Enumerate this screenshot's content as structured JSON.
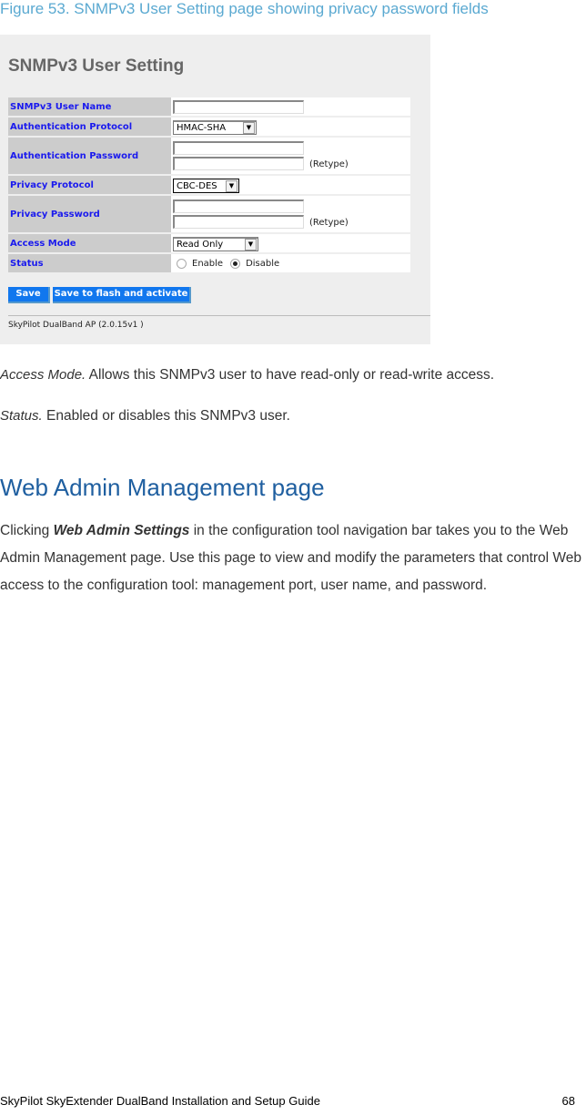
{
  "caption": "Figure 53. SNMPv3 User Setting page showing privacy password fields",
  "screenshot": {
    "title": "SNMPv3 User Setting",
    "fields": {
      "user_name": {
        "label": "SNMPv3 User Name",
        "value": ""
      },
      "auth_protocol": {
        "label": "Authentication Protocol",
        "selected": "HMAC-SHA"
      },
      "auth_password": {
        "label": "Authentication Password",
        "value": "",
        "retype_value": "",
        "retype_label": "(Retype)"
      },
      "privacy_protocol": {
        "label": "Privacy Protocol",
        "selected": "CBC-DES"
      },
      "privacy_password": {
        "label": "Privacy Password",
        "value": "",
        "retype_value": "",
        "retype_label": "(Retype)"
      },
      "access_mode": {
        "label": "Access Mode",
        "selected": "Read Only"
      },
      "status": {
        "label": "Status",
        "options": [
          "Enable",
          "Disable"
        ],
        "selected": "Disable"
      }
    },
    "buttons": {
      "save": "Save",
      "save_flash": "Save to flash and activate"
    },
    "footer": "SkyPilot DualBand AP (2.0.15v1 )"
  },
  "descriptions": {
    "access_mode": {
      "term": "Access Mode.",
      "text": " Allows this SNMPv3 user to have read-only or read-write access."
    },
    "status": {
      "term": "Status.",
      "text": " Enabled or disables this SNMPv3 user."
    }
  },
  "section": {
    "heading": "Web Admin Management page",
    "intro_before": "Clicking ",
    "intro_term": "Web Admin Settings",
    "intro_after": " in the configuration tool navigation bar takes you to the Web Admin Management page. Use this page to view and modify the parameters that control Web access to the configuration tool: management port, user name, and password."
  },
  "page_footer": {
    "title": "SkyPilot SkyExtender DualBand Installation and Setup Guide",
    "page_number": "68"
  }
}
